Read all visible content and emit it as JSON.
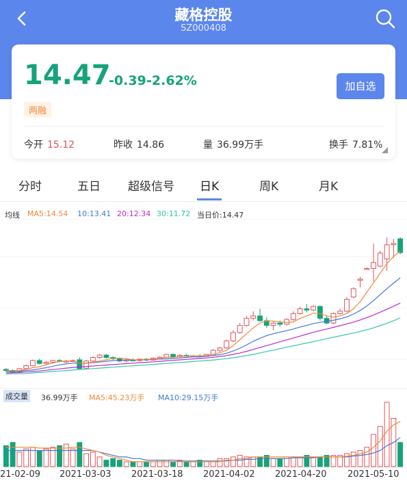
{
  "header": {
    "title": "藏格控股",
    "code": "SZ000408",
    "back_icon": "chevron-left-icon",
    "search_icon": "search-icon"
  },
  "quote": {
    "price": "14.47",
    "change": "-0.39",
    "change_pct": "-2.62%",
    "badge": "两融",
    "add_button": "加自选",
    "stats": [
      {
        "label": "今开",
        "value": "15.12"
      },
      {
        "label": "昨收",
        "value": "14.86"
      },
      {
        "label": "量",
        "value": "36.99万手"
      },
      {
        "label": "换手",
        "value": "7.81%"
      }
    ],
    "colors": {
      "down": "#16a37a",
      "up": "#e0525b",
      "accent": "#5b86ec"
    }
  },
  "tabs": [
    "分时",
    "五日",
    "超级信号",
    "日K",
    "周K",
    "月K"
  ],
  "active_tab": "日K",
  "ma_legend": {
    "label": "均线",
    "ma5": "MA5:14.54",
    "ma10": "10:13.41",
    "ma20": "20:12.34",
    "ma30": "30:11.72",
    "current": "当日价:14.47"
  },
  "volume_legend": {
    "label": "成交量",
    "value": "36.99万手",
    "ma5": "MA5:45.23万手",
    "ma10": "MA10:29.15万手"
  },
  "dates": [
    "21-02-09",
    "2021-03-03",
    "2021-03-18",
    "2021-04-02",
    "2021-04-20",
    "2021-05-10"
  ],
  "chart_data": {
    "type": "candlestick",
    "candles": [
      [
        9.55,
        9.6,
        9.45,
        9.5,
        "down"
      ],
      [
        9.5,
        9.55,
        9.4,
        9.42,
        "down"
      ],
      [
        9.45,
        9.6,
        9.42,
        9.58,
        "up"
      ],
      [
        9.58,
        9.75,
        9.55,
        9.7,
        "up"
      ],
      [
        9.7,
        9.95,
        9.68,
        9.92,
        "up"
      ],
      [
        9.92,
        10.0,
        9.75,
        9.8,
        "down"
      ],
      [
        9.8,
        9.9,
        9.75,
        9.85,
        "up"
      ],
      [
        9.85,
        9.95,
        9.8,
        9.92,
        "up"
      ],
      [
        9.92,
        9.98,
        9.85,
        9.88,
        "down"
      ],
      [
        9.88,
        9.95,
        9.82,
        9.9,
        "up"
      ],
      [
        9.9,
        9.95,
        9.88,
        9.92,
        "up"
      ],
      [
        9.95,
        10.05,
        9.55,
        9.58,
        "down"
      ],
      [
        9.6,
        9.95,
        9.55,
        9.9,
        "up"
      ],
      [
        9.9,
        10.1,
        9.85,
        10.05,
        "up"
      ],
      [
        10.05,
        10.2,
        10.0,
        10.15,
        "up"
      ],
      [
        10.15,
        10.2,
        10.0,
        10.05,
        "down"
      ],
      [
        10.05,
        10.1,
        9.95,
        10.0,
        "down"
      ],
      [
        10.0,
        10.05,
        9.85,
        9.9,
        "down"
      ],
      [
        9.9,
        9.98,
        9.85,
        9.95,
        "up"
      ],
      [
        9.95,
        10.02,
        9.88,
        9.92,
        "down"
      ],
      [
        9.92,
        10.0,
        9.88,
        9.98,
        "up"
      ],
      [
        9.98,
        10.02,
        9.9,
        9.94,
        "down"
      ],
      [
        9.94,
        10.05,
        9.92,
        10.02,
        "up"
      ],
      [
        10.02,
        10.1,
        9.98,
        10.06,
        "up"
      ],
      [
        10.06,
        10.2,
        10.02,
        10.18,
        "up"
      ],
      [
        10.18,
        10.22,
        10.05,
        10.08,
        "down"
      ],
      [
        10.08,
        10.18,
        10.05,
        10.14,
        "up"
      ],
      [
        10.14,
        10.2,
        10.08,
        10.1,
        "down"
      ],
      [
        10.1,
        10.16,
        10.05,
        10.12,
        "up"
      ],
      [
        10.12,
        10.18,
        10.06,
        10.1,
        "down"
      ],
      [
        10.1,
        10.2,
        10.08,
        10.18,
        "up"
      ],
      [
        10.18,
        10.4,
        10.15,
        10.35,
        "up"
      ],
      [
        10.35,
        10.5,
        10.28,
        10.45,
        "up"
      ],
      [
        10.45,
        10.8,
        10.42,
        10.75,
        "up"
      ],
      [
        10.75,
        11.2,
        10.7,
        11.1,
        "up"
      ],
      [
        11.1,
        11.5,
        11.05,
        11.4,
        "up"
      ],
      [
        11.4,
        11.8,
        11.35,
        11.7,
        "up"
      ],
      [
        11.7,
        12.0,
        11.6,
        11.8,
        "up"
      ],
      [
        11.8,
        12.1,
        11.55,
        11.6,
        "down"
      ],
      [
        11.6,
        11.75,
        11.3,
        11.4,
        "down"
      ],
      [
        11.4,
        11.55,
        11.2,
        11.5,
        "up"
      ],
      [
        11.5,
        11.6,
        11.35,
        11.45,
        "down"
      ],
      [
        11.45,
        11.7,
        11.4,
        11.65,
        "up"
      ],
      [
        11.65,
        12.0,
        11.6,
        11.9,
        "up"
      ],
      [
        11.9,
        12.2,
        11.85,
        12.1,
        "up"
      ],
      [
        12.1,
        12.3,
        11.95,
        12.05,
        "down"
      ],
      [
        12.05,
        12.25,
        12.0,
        12.2,
        "up"
      ],
      [
        12.2,
        12.25,
        11.6,
        11.7,
        "down"
      ],
      [
        11.7,
        11.8,
        11.45,
        11.5,
        "down"
      ],
      [
        11.5,
        11.95,
        11.45,
        11.9,
        "up"
      ],
      [
        11.9,
        12.1,
        11.85,
        12.0,
        "up"
      ],
      [
        12.0,
        12.6,
        11.95,
        12.5,
        "up"
      ],
      [
        12.6,
        13.0,
        12.55,
        12.95,
        "up"
      ],
      [
        13.3,
        13.45,
        13.0,
        13.35,
        "up"
      ],
      [
        13.8,
        13.85,
        13.75,
        13.8,
        "up"
      ],
      [
        14.05,
        14.85,
        13.25,
        13.8,
        "up"
      ],
      [
        13.9,
        14.55,
        13.85,
        14.45,
        "up"
      ],
      [
        14.2,
        15.1,
        13.7,
        14.8,
        "up"
      ],
      [
        14.8,
        15.05,
        14.25,
        14.85,
        "up"
      ],
      [
        15.05,
        15.12,
        14.4,
        14.47,
        "down"
      ]
    ],
    "ma5": [
      9.5,
      9.48,
      9.5,
      9.55,
      9.62,
      9.66,
      9.74,
      9.82,
      9.88,
      9.9,
      9.9,
      9.8,
      9.82,
      9.85,
      9.9,
      9.95,
      10.02,
      10.02,
      10.0,
      9.95,
      9.95,
      9.96,
      9.98,
      10.0,
      10.05,
      10.06,
      10.09,
      10.11,
      10.12,
      10.11,
      10.13,
      10.18,
      10.25,
      10.35,
      10.55,
      10.8,
      11.05,
      11.3,
      11.5,
      11.6,
      11.58,
      11.55,
      11.52,
      11.55,
      11.7,
      11.8,
      11.92,
      11.9,
      11.8,
      11.75,
      11.8,
      11.9,
      12.1,
      12.4,
      12.8,
      13.2,
      13.6,
      14.0,
      14.3,
      14.54
    ],
    "ma10": [
      9.45,
      9.46,
      9.47,
      9.5,
      9.53,
      9.57,
      9.62,
      9.68,
      9.74,
      9.78,
      9.81,
      9.8,
      9.81,
      9.83,
      9.86,
      9.89,
      9.92,
      9.93,
      9.94,
      9.94,
      9.95,
      9.96,
      9.97,
      9.98,
      9.99,
      10.01,
      10.03,
      10.05,
      10.07,
      10.08,
      10.1,
      10.13,
      10.17,
      10.23,
      10.32,
      10.44,
      10.58,
      10.73,
      10.86,
      10.97,
      11.05,
      11.12,
      11.18,
      11.25,
      11.33,
      11.4,
      11.48,
      11.53,
      11.57,
      11.62,
      11.68,
      11.76,
      11.88,
      12.03,
      12.22,
      12.45,
      12.7,
      12.95,
      13.18,
      13.41
    ],
    "ma20": [
      9.4,
      9.41,
      9.42,
      9.44,
      9.46,
      9.48,
      9.51,
      9.54,
      9.57,
      9.6,
      9.63,
      9.65,
      9.67,
      9.69,
      9.71,
      9.73,
      9.75,
      9.77,
      9.79,
      9.81,
      9.83,
      9.85,
      9.87,
      9.89,
      9.91,
      9.93,
      9.95,
      9.97,
      9.99,
      10.01,
      10.03,
      10.06,
      10.09,
      10.13,
      10.18,
      10.24,
      10.31,
      10.39,
      10.47,
      10.55,
      10.63,
      10.71,
      10.79,
      10.87,
      10.95,
      11.03,
      11.11,
      11.18,
      11.25,
      11.32,
      11.39,
      11.46,
      11.54,
      11.63,
      11.73,
      11.84,
      11.96,
      12.08,
      12.21,
      12.34
    ],
    "ma30": [
      9.35,
      9.36,
      9.37,
      9.38,
      9.4,
      9.42,
      9.44,
      9.46,
      9.48,
      9.5,
      9.52,
      9.54,
      9.56,
      9.58,
      9.6,
      9.62,
      9.64,
      9.66,
      9.68,
      9.7,
      9.72,
      9.74,
      9.76,
      9.78,
      9.8,
      9.82,
      9.84,
      9.86,
      9.88,
      9.9,
      9.92,
      9.94,
      9.97,
      10.0,
      10.04,
      10.08,
      10.13,
      10.18,
      10.24,
      10.3,
      10.36,
      10.42,
      10.48,
      10.54,
      10.6,
      10.66,
      10.72,
      10.78,
      10.84,
      10.9,
      10.96,
      11.02,
      11.08,
      11.15,
      11.22,
      11.3,
      11.39,
      11.49,
      11.6,
      11.72
    ],
    "volume": [
      13,
      15,
      9,
      11,
      12,
      10,
      11,
      12,
      13,
      14,
      11,
      15,
      8,
      9,
      6,
      4,
      5,
      4,
      3,
      3,
      3,
      3,
      3,
      4,
      4,
      3,
      4,
      3,
      3,
      4,
      3,
      3,
      5,
      5,
      6,
      7,
      6,
      6,
      6,
      7,
      5,
      5,
      6,
      6,
      6,
      7,
      6,
      6,
      7,
      7,
      7,
      8,
      9,
      10,
      12,
      20,
      25,
      40,
      30,
      15
    ],
    "vol_ma5": [
      12,
      12,
      12,
      12,
      12,
      11.5,
      11.5,
      11.5,
      11.5,
      11.5,
      12,
      12,
      11,
      10,
      9,
      7,
      6,
      5,
      4,
      3,
      3,
      3,
      3,
      3,
      3,
      3,
      3,
      3,
      3,
      3,
      3,
      3,
      3,
      4,
      4,
      5,
      5,
      6,
      6,
      6,
      6,
      6,
      6,
      6,
      6,
      6,
      6,
      6,
      6,
      6,
      6,
      6.5,
      7,
      8,
      9,
      12,
      16,
      22,
      26,
      28
    ],
    "vol_ma10": [
      10,
      10,
      10,
      10,
      10,
      10,
      10,
      10,
      10,
      10,
      10,
      10,
      10,
      10,
      9,
      8,
      7,
      6,
      6,
      5,
      5,
      4,
      4,
      4,
      4,
      4,
      3.5,
      3.5,
      3.5,
      3.5,
      3.5,
      3.5,
      3.5,
      3.5,
      4,
      4,
      4.5,
      4.5,
      5,
      5,
      5,
      5,
      5,
      5.5,
      5.5,
      5.5,
      5.5,
      6,
      6,
      6,
      6,
      6,
      6.5,
      7,
      7.5,
      8.5,
      10,
      13,
      15,
      18
    ],
    "ylim": [
      9.2,
      15.6
    ]
  }
}
